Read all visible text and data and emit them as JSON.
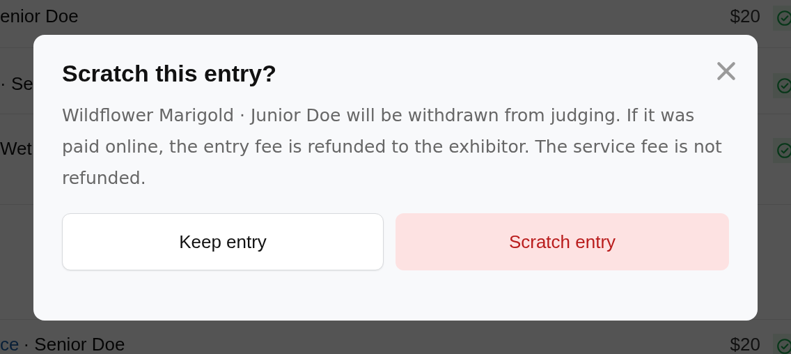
{
  "entries": [
    {
      "name": "enior Doe",
      "fee": "$20",
      "paid": true
    },
    {
      "name": "· Se",
      "paid": true
    },
    {
      "name": "Wet",
      "paid": true
    },
    {
      "link": "ce",
      "name": "· Senior Doe",
      "fee": "$20",
      "paid": true
    }
  ],
  "dialog": {
    "title": "Scratch this entry?",
    "message": "Wildflower Marigold · Junior Doe will be withdrawn from judging. If it was paid online, the entry fee is refunded to the exhibitor. The service fee is not refunded.",
    "buttons": [
      {
        "label": "Keep entry",
        "kind": "secondary"
      },
      {
        "label": "Scratch entry",
        "kind": "danger"
      }
    ]
  }
}
